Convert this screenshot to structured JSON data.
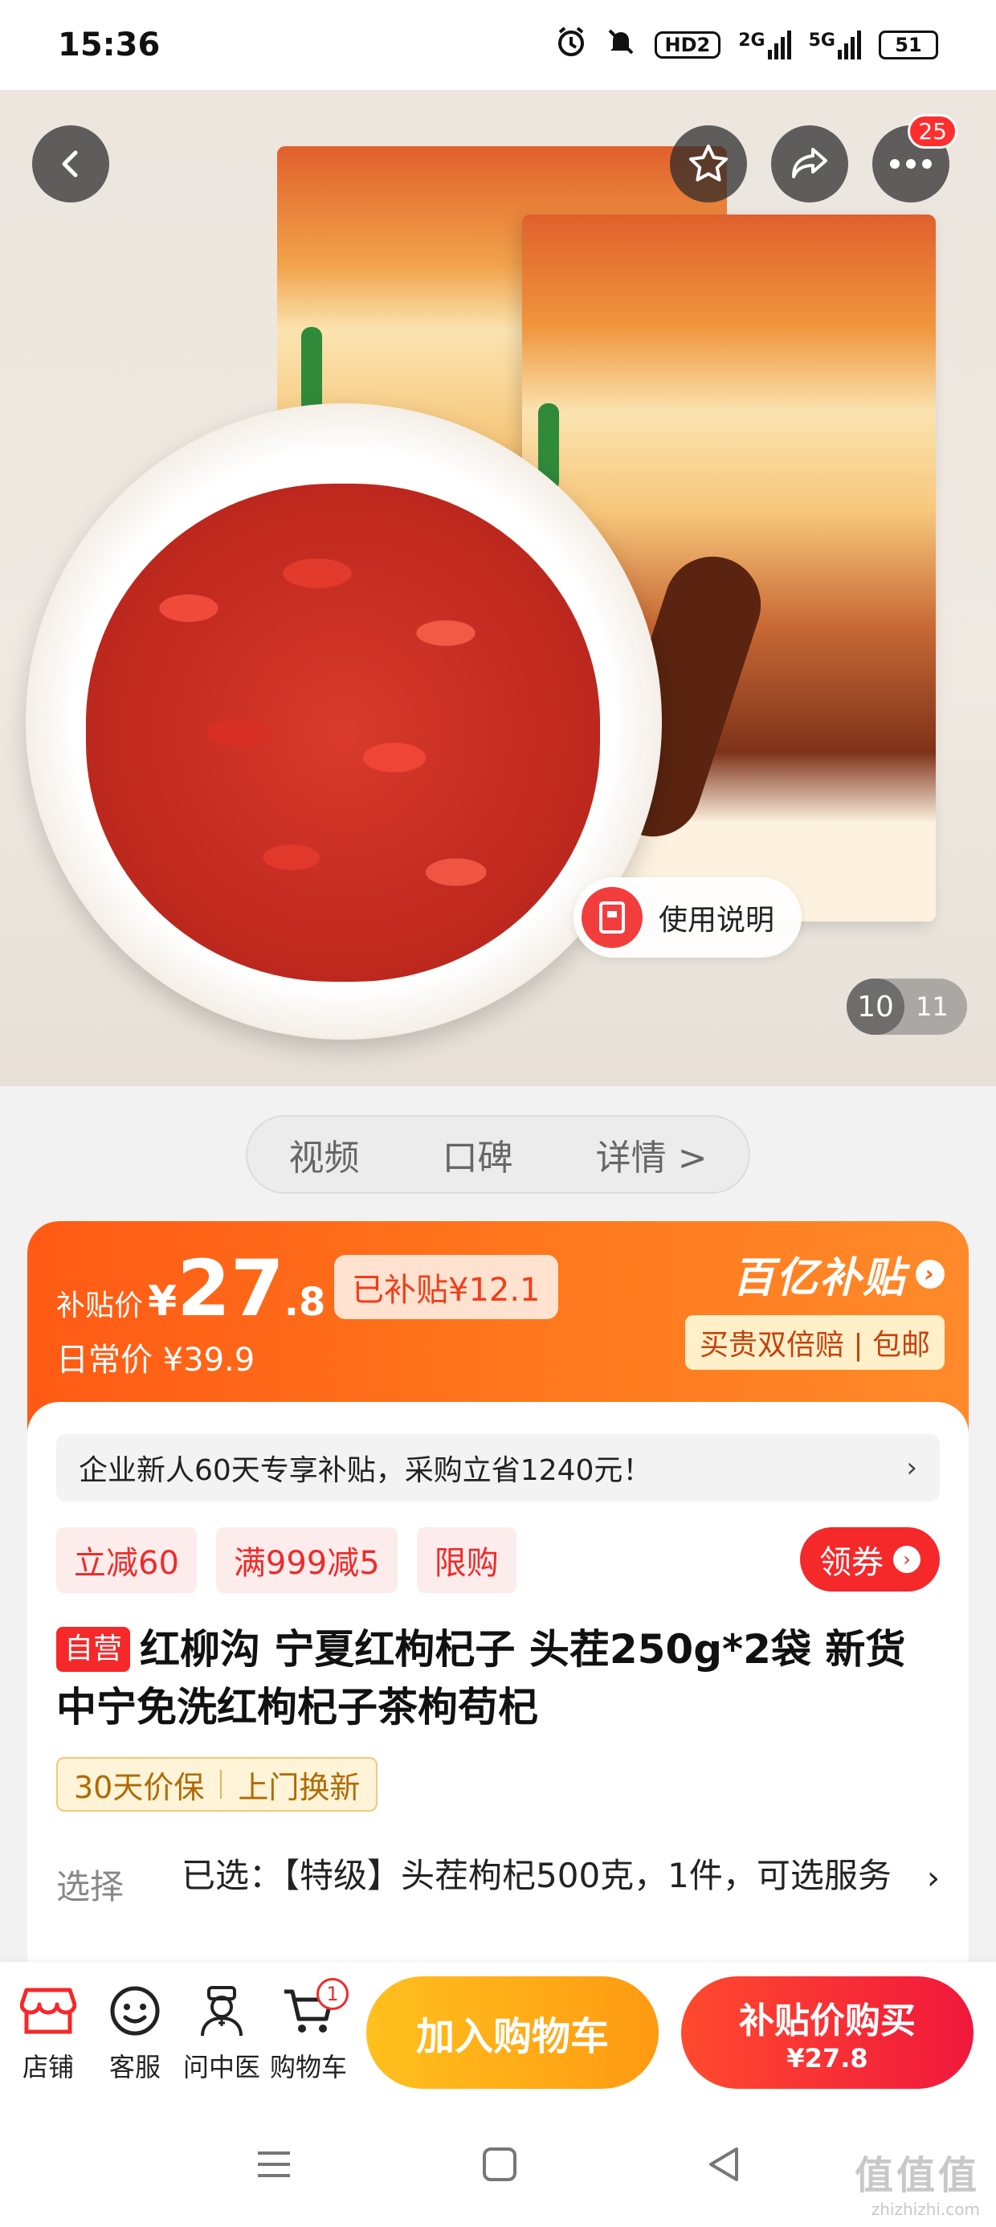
{
  "status_bar": {
    "time": "15:36",
    "hd_label": "HD2",
    "signal_2g": "2G",
    "signal_5g": "5G",
    "battery": "51"
  },
  "hero": {
    "manual_label": "使用说明",
    "pager_current": "10",
    "pager_total": "11",
    "more_badge": "25",
    "icons": [
      "back-icon",
      "favorite-star-icon",
      "share-icon",
      "more-icon"
    ]
  },
  "section_tabs": [
    "视频",
    "口碑",
    "详情 >"
  ],
  "price": {
    "label": "补贴价",
    "yen": "¥",
    "integer": "27",
    "decimal": ".8",
    "subsidy_chip": "已补贴¥12.1",
    "regular": "日常价 ¥39.9",
    "program_title": "百亿补贴",
    "program_tags": "买贵双倍赔 | 包邮"
  },
  "detail": {
    "notice": "企业新人60天专享补贴，采购立省1240元！",
    "promos": [
      "立减60",
      "满999减5",
      "限购"
    ],
    "coupon_label": "领券",
    "self_tag": "自营",
    "title": "红柳沟 宁夏红枸杞子 头茬250g*2袋 新货中宁免洗红枸杞子茶枸苟杞",
    "service_tags": [
      "30天价保",
      "上门换新"
    ],
    "select_label": "选择",
    "select_value": "已选：【特级】头茬枸杞500克，1件，可选服务"
  },
  "bottom_bar": {
    "nav": [
      {
        "label": "店铺",
        "icon": "store-icon"
      },
      {
        "label": "客服",
        "icon": "customer-service-icon"
      },
      {
        "label": "问中医",
        "icon": "doctor-icon"
      },
      {
        "label": "购物车",
        "icon": "cart-icon",
        "badge": "1"
      }
    ],
    "add_cart": "加入购物车",
    "buy_title": "补贴价购买",
    "buy_price": "¥27.8"
  },
  "watermark": {
    "line1": "值值值",
    "line2": "zhizhizhi.com"
  },
  "colors": {
    "accent_red": "#f5282a",
    "orange": "#ff5a14",
    "yellow_button": "#ffc01d"
  }
}
